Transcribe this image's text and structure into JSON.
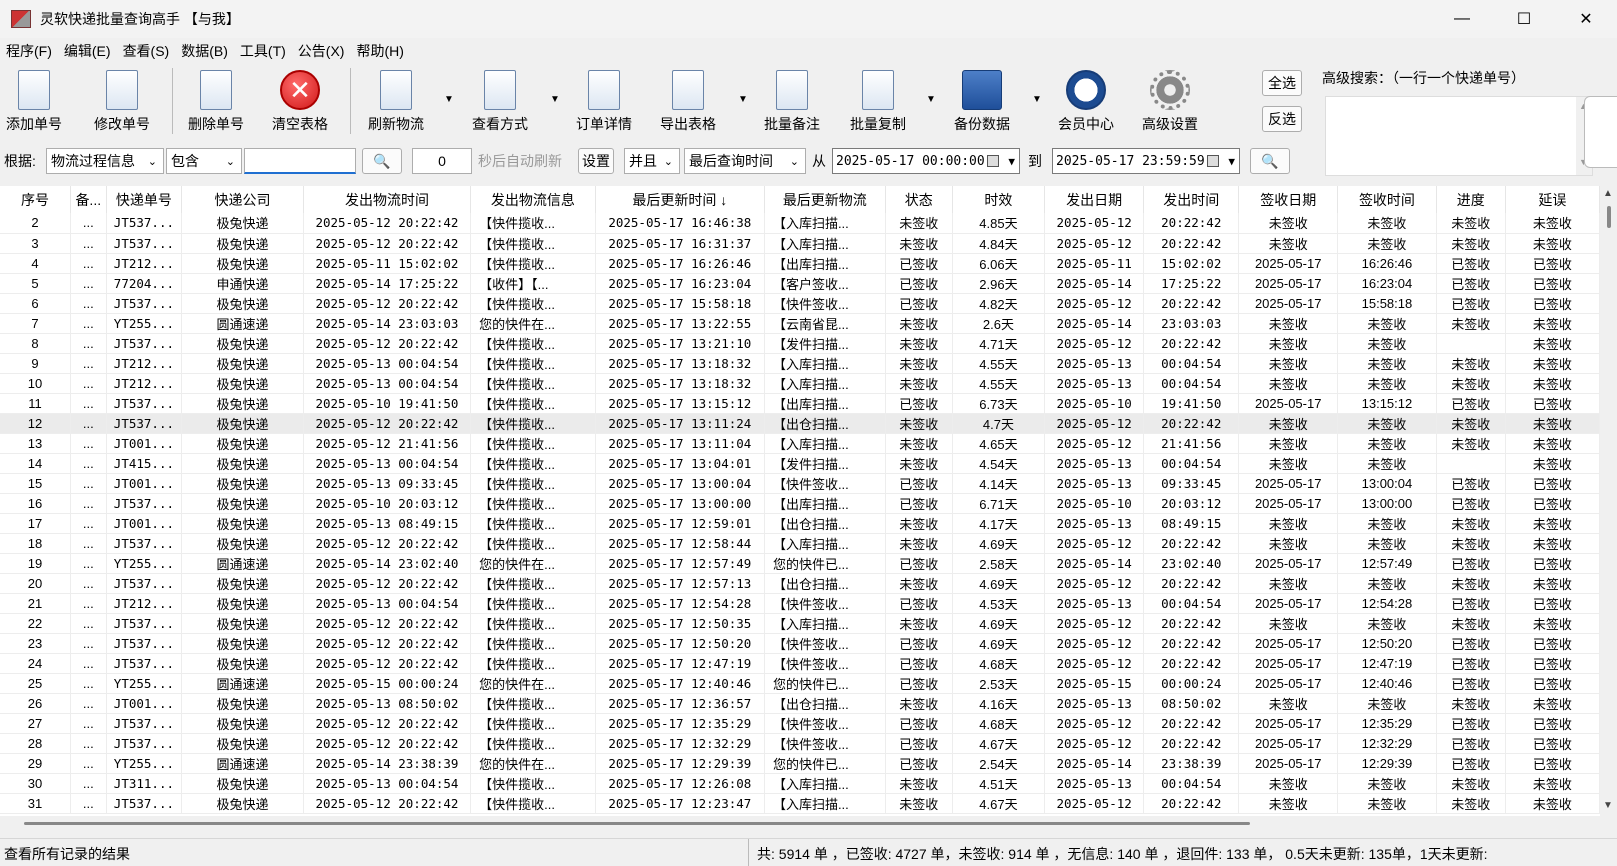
{
  "window": {
    "title": "灵软快递批量查询高手 【与我】"
  },
  "menu": [
    "程序(F)",
    "编辑(E)",
    "查看(S)",
    "数据(B)",
    "工具(T)",
    "公告(X)",
    "帮助(H)"
  ],
  "toolbar": {
    "add": "添加单号",
    "edit": "修改单号",
    "delete": "删除单号",
    "clear": "清空表格",
    "refresh": "刷新物流",
    "view_mode": "查看方式",
    "order_detail": "订单详情",
    "export": "导出表格",
    "batch_note": "批量备注",
    "batch_copy": "批量复制",
    "backup": "备份数据",
    "member": "会员中心",
    "advanced": "高级设置",
    "select_all": "全选",
    "invert": "反选"
  },
  "advanced_search": {
    "label": "高级搜索：（一行一个快递单号）",
    "value": ""
  },
  "filter": {
    "basis_label": "根据:",
    "field": "物流过程信息",
    "op": "包含",
    "keyword": "",
    "interval": "0",
    "auto_refresh_label": "秒后自动刷新",
    "settings": "设置",
    "logic": "并且",
    "time_field": "最后查询时间",
    "from_label": "从",
    "from_date": "2025-05-17 00:00:00",
    "to_label": "到",
    "to_date": "2025-05-17 23:59:59"
  },
  "table": {
    "columns": [
      "序号",
      "备...",
      "快递单号",
      "快递公司",
      "发出物流时间",
      "发出物流信息",
      "最后更新时间 ↓",
      "最后更新物流",
      "状态",
      "时效",
      "发出日期",
      "发出时间",
      "签收日期",
      "签收时间",
      "进度",
      "延误"
    ],
    "rows": [
      [
        "2",
        "...",
        "JT537...",
        "极兔快递",
        "2025-05-12 20:22:42",
        "【快件揽收...",
        "2025-05-17 16:46:38",
        "【入库扫描...",
        "未签收",
        "4.85天",
        "2025-05-12",
        "20:22:42",
        "未签收",
        "未签收",
        "未签收",
        "未签收"
      ],
      [
        "3",
        "...",
        "JT537...",
        "极兔快递",
        "2025-05-12 20:22:42",
        "【快件揽收...",
        "2025-05-17 16:31:37",
        "【入库扫描...",
        "未签收",
        "4.84天",
        "2025-05-12",
        "20:22:42",
        "未签收",
        "未签收",
        "未签收",
        "未签收"
      ],
      [
        "4",
        "...",
        "JT212...",
        "极兔快递",
        "2025-05-11 15:02:02",
        "【快件揽收...",
        "2025-05-17 16:26:46",
        "【出库扫描...",
        "已签收",
        "6.06天",
        "2025-05-11",
        "15:02:02",
        "2025-05-17",
        "16:26:46",
        "已签收",
        "已签收"
      ],
      [
        "5",
        "...",
        "77204...",
        "申通快递",
        "2025-05-14 17:25:22",
        "【收件】【...",
        "2025-05-17 16:23:04",
        "【客户签收...",
        "已签收",
        "2.96天",
        "2025-05-14",
        "17:25:22",
        "2025-05-17",
        "16:23:04",
        "已签收",
        "已签收"
      ],
      [
        "6",
        "...",
        "JT537...",
        "极兔快递",
        "2025-05-12 20:22:42",
        "【快件揽收...",
        "2025-05-17 15:58:18",
        "【快件签收...",
        "已签收",
        "4.82天",
        "2025-05-12",
        "20:22:42",
        "2025-05-17",
        "15:58:18",
        "已签收",
        "已签收"
      ],
      [
        "7",
        "...",
        "YT255...",
        "圆通速递",
        "2025-05-14 23:03:03",
        "您的快件在...",
        "2025-05-17 13:22:55",
        "【云南省昆...",
        "未签收",
        "2.6天",
        "2025-05-14",
        "23:03:03",
        "未签收",
        "未签收",
        "未签收",
        "未签收"
      ],
      [
        "8",
        "...",
        "JT537...",
        "极兔快递",
        "2025-05-12 20:22:42",
        "【快件揽收...",
        "2025-05-17 13:21:10",
        "【发件扫描...",
        "未签收",
        "4.71天",
        "2025-05-12",
        "20:22:42",
        "未签收",
        "未签收",
        "",
        "未签收"
      ],
      [
        "9",
        "...",
        "JT212...",
        "极兔快递",
        "2025-05-13 00:04:54",
        "【快件揽收...",
        "2025-05-17 13:18:32",
        "【入库扫描...",
        "未签收",
        "4.55天",
        "2025-05-13",
        "00:04:54",
        "未签收",
        "未签收",
        "未签收",
        "未签收"
      ],
      [
        "10",
        "...",
        "JT212...",
        "极兔快递",
        "2025-05-13 00:04:54",
        "【快件揽收...",
        "2025-05-17 13:18:32",
        "【入库扫描...",
        "未签收",
        "4.55天",
        "2025-05-13",
        "00:04:54",
        "未签收",
        "未签收",
        "未签收",
        "未签收"
      ],
      [
        "11",
        "...",
        "JT537...",
        "极兔快递",
        "2025-05-10 19:41:50",
        "【快件揽收...",
        "2025-05-17 13:15:12",
        "【出库扫描...",
        "已签收",
        "6.73天",
        "2025-05-10",
        "19:41:50",
        "2025-05-17",
        "13:15:12",
        "已签收",
        "已签收"
      ],
      [
        "12",
        "...",
        "JT537...",
        "极兔快递",
        "2025-05-12 20:22:42",
        "【快件揽收...",
        "2025-05-17 13:11:24",
        "【出仓扫描...",
        "未签收",
        "4.7天",
        "2025-05-12",
        "20:22:42",
        "未签收",
        "未签收",
        "未签收",
        "未签收"
      ],
      [
        "13",
        "...",
        "JT001...",
        "极兔快递",
        "2025-05-12 21:41:56",
        "【快件揽收...",
        "2025-05-17 13:11:04",
        "【入库扫描...",
        "未签收",
        "4.65天",
        "2025-05-12",
        "21:41:56",
        "未签收",
        "未签收",
        "未签收",
        "未签收"
      ],
      [
        "14",
        "...",
        "JT415...",
        "极兔快递",
        "2025-05-13 00:04:54",
        "【快件揽收...",
        "2025-05-17 13:04:01",
        "【发件扫描...",
        "未签收",
        "4.54天",
        "2025-05-13",
        "00:04:54",
        "未签收",
        "未签收",
        "",
        "未签收"
      ],
      [
        "15",
        "...",
        "JT001...",
        "极兔快递",
        "2025-05-13 09:33:45",
        "【快件揽收...",
        "2025-05-17 13:00:04",
        "【快件签收...",
        "已签收",
        "4.14天",
        "2025-05-13",
        "09:33:45",
        "2025-05-17",
        "13:00:04",
        "已签收",
        "已签收"
      ],
      [
        "16",
        "...",
        "JT537...",
        "极兔快递",
        "2025-05-10 20:03:12",
        "【快件揽收...",
        "2025-05-17 13:00:00",
        "【出库扫描...",
        "已签收",
        "6.71天",
        "2025-05-10",
        "20:03:12",
        "2025-05-17",
        "13:00:00",
        "已签收",
        "已签收"
      ],
      [
        "17",
        "...",
        "JT001...",
        "极兔快递",
        "2025-05-13 08:49:15",
        "【快件揽收...",
        "2025-05-17 12:59:01",
        "【出仓扫描...",
        "未签收",
        "4.17天",
        "2025-05-13",
        "08:49:15",
        "未签收",
        "未签收",
        "未签收",
        "未签收"
      ],
      [
        "18",
        "...",
        "JT537...",
        "极兔快递",
        "2025-05-12 20:22:42",
        "【快件揽收...",
        "2025-05-17 12:58:44",
        "【入库扫描...",
        "未签收",
        "4.69天",
        "2025-05-12",
        "20:22:42",
        "未签收",
        "未签收",
        "未签收",
        "未签收"
      ],
      [
        "19",
        "...",
        "YT255...",
        "圆通速递",
        "2025-05-14 23:02:40",
        "您的快件在...",
        "2025-05-17 12:57:49",
        "您的快件已...",
        "已签收",
        "2.58天",
        "2025-05-14",
        "23:02:40",
        "2025-05-17",
        "12:57:49",
        "已签收",
        "已签收"
      ],
      [
        "20",
        "...",
        "JT537...",
        "极兔快递",
        "2025-05-12 20:22:42",
        "【快件揽收...",
        "2025-05-17 12:57:13",
        "【出仓扫描...",
        "未签收",
        "4.69天",
        "2025-05-12",
        "20:22:42",
        "未签收",
        "未签收",
        "未签收",
        "未签收"
      ],
      [
        "21",
        "...",
        "JT212...",
        "极兔快递",
        "2025-05-13 00:04:54",
        "【快件揽收...",
        "2025-05-17 12:54:28",
        "【快件签收...",
        "已签收",
        "4.53天",
        "2025-05-13",
        "00:04:54",
        "2025-05-17",
        "12:54:28",
        "已签收",
        "已签收"
      ],
      [
        "22",
        "...",
        "JT537...",
        "极兔快递",
        "2025-05-12 20:22:42",
        "【快件揽收...",
        "2025-05-17 12:50:35",
        "【入库扫描...",
        "未签收",
        "4.69天",
        "2025-05-12",
        "20:22:42",
        "未签收",
        "未签收",
        "未签收",
        "未签收"
      ],
      [
        "23",
        "...",
        "JT537...",
        "极兔快递",
        "2025-05-12 20:22:42",
        "【快件揽收...",
        "2025-05-17 12:50:20",
        "【快件签收...",
        "已签收",
        "4.69天",
        "2025-05-12",
        "20:22:42",
        "2025-05-17",
        "12:50:20",
        "已签收",
        "已签收"
      ],
      [
        "24",
        "...",
        "JT537...",
        "极兔快递",
        "2025-05-12 20:22:42",
        "【快件揽收...",
        "2025-05-17 12:47:19",
        "【快件签收...",
        "已签收",
        "4.68天",
        "2025-05-12",
        "20:22:42",
        "2025-05-17",
        "12:47:19",
        "已签收",
        "已签收"
      ],
      [
        "25",
        "...",
        "YT255...",
        "圆通速递",
        "2025-05-15 00:00:24",
        "您的快件在...",
        "2025-05-17 12:40:46",
        "您的快件已...",
        "已签收",
        "2.53天",
        "2025-05-15",
        "00:00:24",
        "2025-05-17",
        "12:40:46",
        "已签收",
        "已签收"
      ],
      [
        "26",
        "...",
        "JT001...",
        "极兔快递",
        "2025-05-13 08:50:02",
        "【快件揽收...",
        "2025-05-17 12:36:57",
        "【出仓扫描...",
        "未签收",
        "4.16天",
        "2025-05-13",
        "08:50:02",
        "未签收",
        "未签收",
        "未签收",
        "未签收"
      ],
      [
        "27",
        "...",
        "JT537...",
        "极兔快递",
        "2025-05-12 20:22:42",
        "【快件揽收...",
        "2025-05-17 12:35:29",
        "【快件签收...",
        "已签收",
        "4.68天",
        "2025-05-12",
        "20:22:42",
        "2025-05-17",
        "12:35:29",
        "已签收",
        "已签收"
      ],
      [
        "28",
        "...",
        "JT537...",
        "极兔快递",
        "2025-05-12 20:22:42",
        "【快件揽收...",
        "2025-05-17 12:32:29",
        "【快件签收...",
        "已签收",
        "4.67天",
        "2025-05-12",
        "20:22:42",
        "2025-05-17",
        "12:32:29",
        "已签收",
        "已签收"
      ],
      [
        "29",
        "...",
        "YT255...",
        "圆通速递",
        "2025-05-14 23:38:39",
        "您的快件在...",
        "2025-05-17 12:29:39",
        "您的快件已...",
        "已签收",
        "2.54天",
        "2025-05-14",
        "23:38:39",
        "2025-05-17",
        "12:29:39",
        "已签收",
        "已签收"
      ],
      [
        "30",
        "...",
        "JT311...",
        "极兔快递",
        "2025-05-13 00:04:54",
        "【快件揽收...",
        "2025-05-17 12:26:08",
        "【入库扫描...",
        "未签收",
        "4.51天",
        "2025-05-13",
        "00:04:54",
        "未签收",
        "未签收",
        "未签收",
        "未签收"
      ],
      [
        "31",
        "...",
        "JT537...",
        "极兔快递",
        "2025-05-12 20:22:42",
        "【快件揽收...",
        "2025-05-17 12:23:47",
        "【入库扫描...",
        "未签收",
        "4.67天",
        "2025-05-12",
        "20:22:42",
        "未签收",
        "未签收",
        "未签收",
        "未签收"
      ]
    ],
    "highlighted_row_seq": "12"
  },
  "status": {
    "left": "查看所有记录的结果",
    "right": "共: 5914 单 ，已签收: 4727 单，未签收: 914 单 ，无信息: 140 单 ，退回件: 133 单， 0.5天未更新: 135单，1天未更新:"
  },
  "colors": {
    "row_highlight": "#ebebeb",
    "input_focus": "#1f6fd1",
    "delete_icon": "#d01818"
  }
}
